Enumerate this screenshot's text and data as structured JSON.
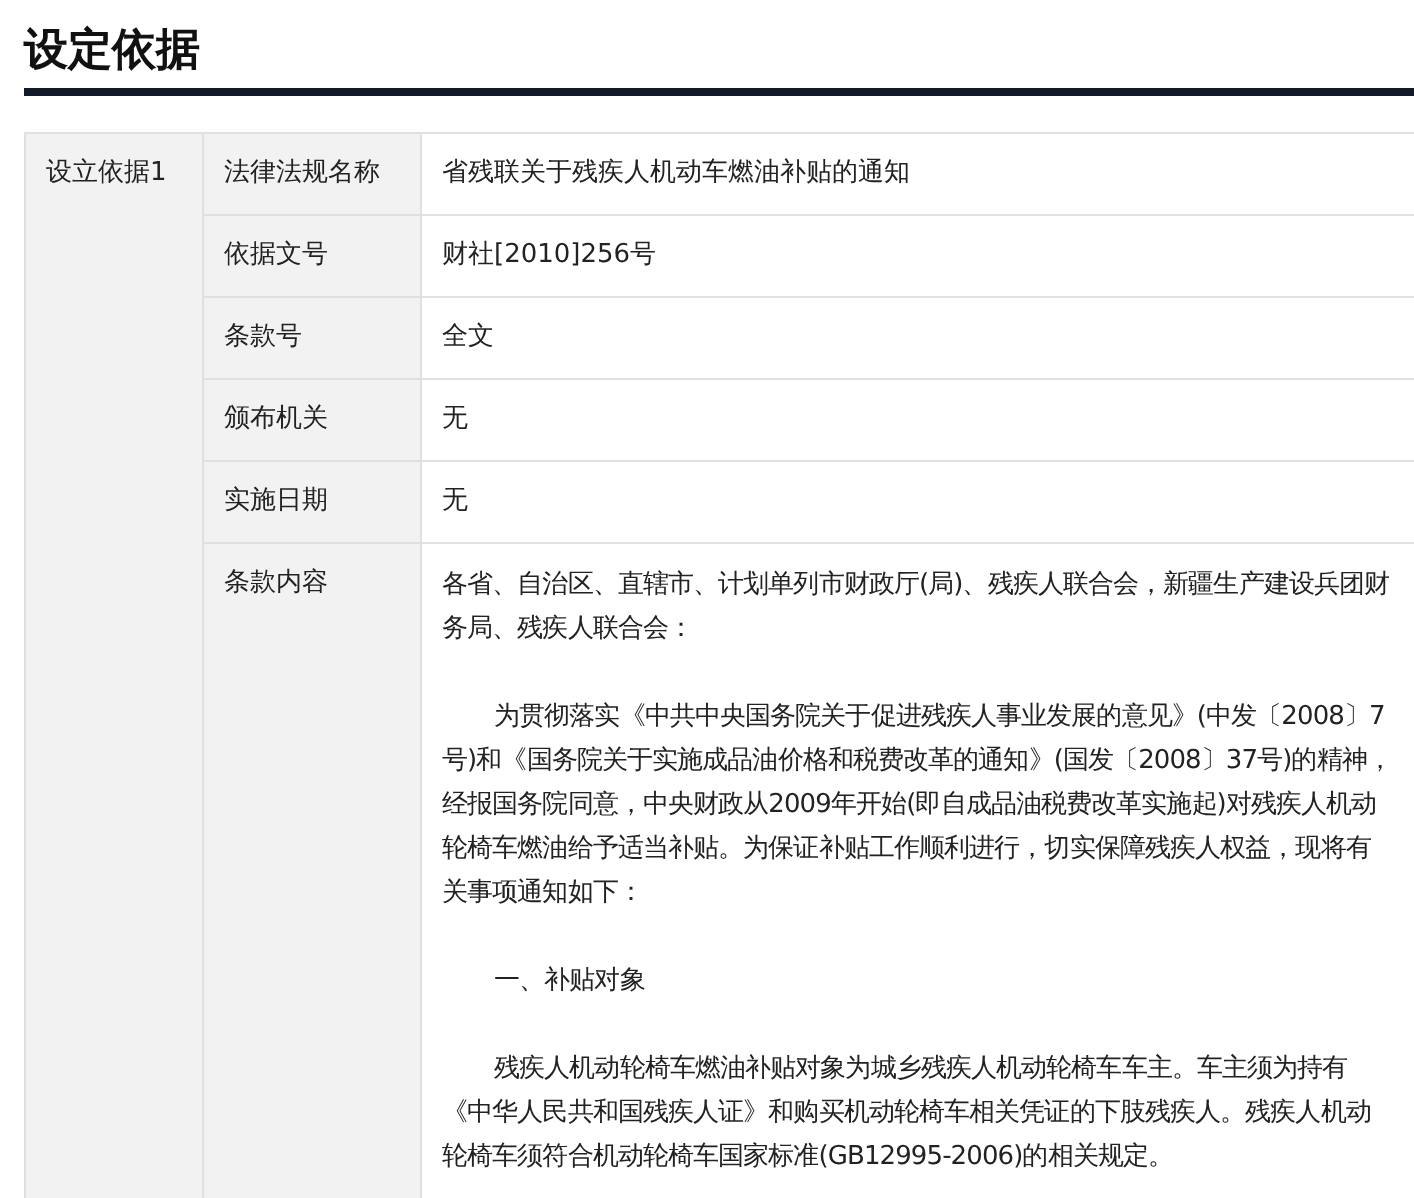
{
  "title": "设定依据",
  "basis": {
    "label": "设立依据1",
    "rows": [
      {
        "label": "法律法规名称",
        "value": "省残联关于残疾人机动车燃油补贴的通知"
      },
      {
        "label": "依据文号",
        "value": "财社[2010]256号"
      },
      {
        "label": "条款号",
        "value": "全文"
      },
      {
        "label": "颁布机关",
        "value": "无"
      },
      {
        "label": "实施日期",
        "value": "无"
      }
    ],
    "content": {
      "label": "条款内容",
      "paragraphs": [
        {
          "text": "各省、自治区、直辖市、计划单列市财政厅(局)、残疾人联合会，新疆生产建设兵团财务局、残疾人联合会：",
          "indent": false
        },
        {
          "text": "为贯彻落实《中共中央国务院关于促进残疾人事业发展的意见》(中发〔2008〕7号)和《国务院关于实施成品油价格和税费改革的通知》(国发〔2008〕37号)的精神，经报国务院同意，中央财政从2009年开始(即自成品油税费改革实施起)对残疾人机动轮椅车燃油给予适当补贴。为保证补贴工作顺利进行，切实保障残疾人权益，现将有关事项通知如下：",
          "indent": true
        },
        {
          "text": "一、补贴对象",
          "indent": true
        },
        {
          "text": "残疾人机动轮椅车燃油补贴对象为城乡残疾人机动轮椅车车主。车主须为持有《中华人民共和国残疾人证》和购买机动轮椅车相关凭证的下肢残疾人。残疾人机动轮椅车须符合机动轮椅车国家标准(GB12995-2006)的相关规定。",
          "indent": true
        }
      ]
    }
  }
}
